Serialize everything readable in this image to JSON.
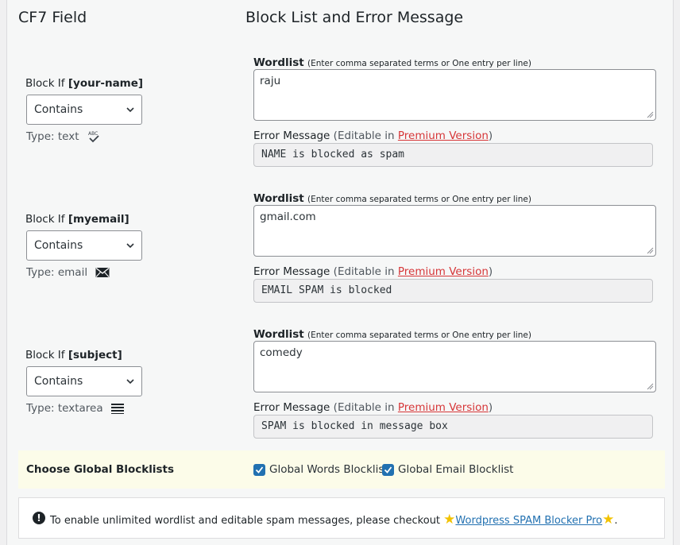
{
  "header": {
    "left_title": "CF7 Field",
    "right_title": "Block List and Error Message"
  },
  "rows": [
    {
      "block_prefix": "Block If ",
      "field": "[your-name]",
      "select_value": "Contains",
      "type_text": "Type: text",
      "type_icon": "spellcheck-icon",
      "wordlist_label": "Wordlist",
      "wordlist_hint": "(Enter comma separated terms or One entry per line)",
      "wordlist_value": "raju",
      "error_label": "Error Message",
      "error_editable": "(Editable in ",
      "premium_link": "Premium Version",
      "error_close": ")",
      "error_value": "NAME is blocked as spam"
    },
    {
      "block_prefix": "Block If ",
      "field": "[myemail]",
      "select_value": "Contains",
      "type_text": "Type: email",
      "type_icon": "envelope-icon",
      "wordlist_label": "Wordlist",
      "wordlist_hint": "(Enter comma separated terms or One entry per line)",
      "wordlist_value": "gmail.com",
      "error_label": "Error Message",
      "error_editable": "(Editable in ",
      "premium_link": "Premium Version",
      "error_close": ")",
      "error_value": "EMAIL SPAM is blocked"
    },
    {
      "block_prefix": "Block If ",
      "field": "[subject]",
      "select_value": "Contains",
      "type_text": "Type: textarea",
      "type_icon": "text-lines-icon",
      "wordlist_label": "Wordlist",
      "wordlist_hint": "(Enter comma separated terms or One entry per line)",
      "wordlist_value": "comedy",
      "error_label": "Error Message",
      "error_editable": "(Editable in ",
      "premium_link": "Premium Version",
      "error_close": ")",
      "error_value": "SPAM is blocked in message box"
    }
  ],
  "global": {
    "label": "Choose Global Blocklists",
    "words_label": "Global Words Blocklist",
    "words_checked": true,
    "email_label": "Global Email Blocklist",
    "email_checked": true
  },
  "notice": {
    "text": "To enable unlimited wordlist and editable spam messages, please checkout ",
    "link": "Wordpress SPAM Blocker Pro",
    "end": "."
  },
  "colors": {
    "checkbox": "#2271b1",
    "premium_link": "#d63638",
    "pro_link": "#2271b1",
    "global_bg": "#fcfce9",
    "star": "#f2c200"
  }
}
